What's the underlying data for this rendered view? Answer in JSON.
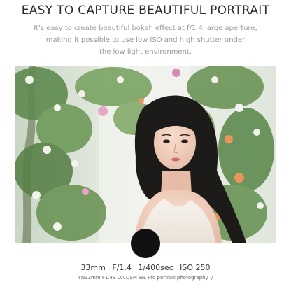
{
  "header": {
    "title": "EASY TO CAPTURE BEAUTIFUL PORTRAIT",
    "description_lines": [
      "It's easy to create beautiful bokeh effect at f/1.4 large aperture,",
      "making it possible to use low ISO and high shutter under",
      "the low light environment."
    ]
  },
  "specs": {
    "focal": "33mm",
    "aperture": "F/1.4",
    "shutter": "1/400sec",
    "iso": "ISO 250"
  },
  "caption": {
    "lens": "YN33mm F1.4S DA DSM WL Pro",
    "category": "portrait photography",
    "separator": "/"
  },
  "colors": {
    "title": "#2b2b2b",
    "description": "#9a9a9a",
    "lens_circle": "#111111"
  }
}
